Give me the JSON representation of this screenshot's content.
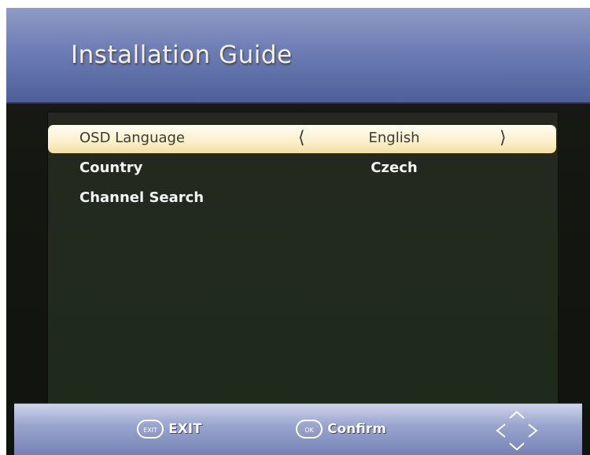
{
  "header": {
    "title": "Installation Guide"
  },
  "menu": {
    "items": [
      {
        "label": "OSD Language",
        "value": "English",
        "selected": true
      },
      {
        "label": "Country",
        "value": "Czech",
        "selected": false
      },
      {
        "label": "Channel Search",
        "value": "",
        "selected": false
      }
    ]
  },
  "footer": {
    "exit_key": "EXIT",
    "exit_label": "EXIT",
    "confirm_key": "OK",
    "confirm_label": "Confirm"
  },
  "colors": {
    "header_blue": "#6d7db4",
    "footer_blue": "#9ba6cf",
    "highlight": "#fbf0c8",
    "panel": "#212a1d"
  },
  "icons": {
    "left_arrow": "chevron-left-icon",
    "right_arrow": "chevron-right-icon",
    "nav": "navigation-arrows-icon"
  }
}
